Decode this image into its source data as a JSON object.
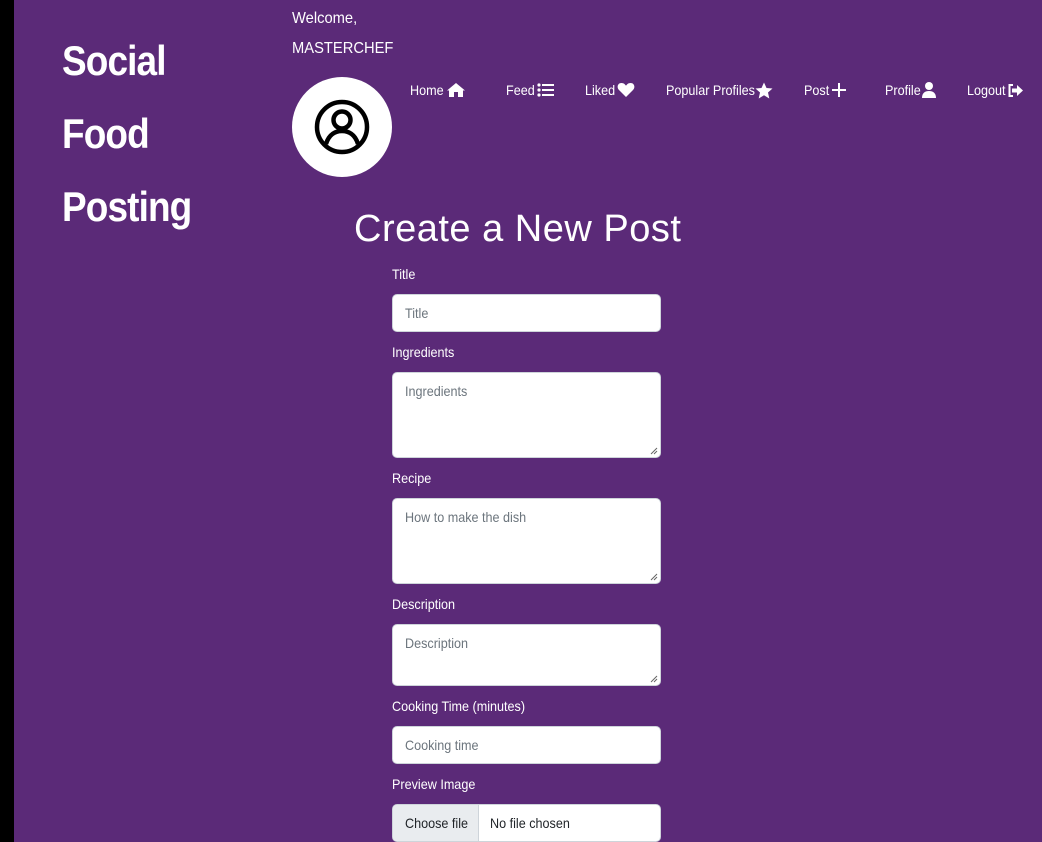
{
  "brand": {
    "line1": "Social Food",
    "line2": "Posting"
  },
  "user": {
    "welcome": "Welcome,",
    "name": "MASTERCHEF"
  },
  "nav": [
    {
      "label": "Home",
      "icon": "home-icon"
    },
    {
      "label": "Feed",
      "icon": "list-icon"
    },
    {
      "label": "Liked",
      "icon": "heart-icon"
    },
    {
      "label": "Popular Profiles",
      "icon": "star-icon"
    },
    {
      "label": "Post",
      "icon": "plus-icon"
    },
    {
      "label": "Profile",
      "icon": "user-icon"
    },
    {
      "label": "Logout",
      "icon": "logout-icon"
    }
  ],
  "page_title": "Create a New Post",
  "form": {
    "title": {
      "label": "Title",
      "placeholder": "Title"
    },
    "ingredients": {
      "label": "Ingredients",
      "placeholder": "Ingredients"
    },
    "recipe": {
      "label": "Recipe",
      "placeholder": "How to make the dish"
    },
    "description": {
      "label": "Description",
      "placeholder": "Description"
    },
    "cooking_time": {
      "label": "Cooking Time (minutes)",
      "placeholder": "Cooking time"
    },
    "preview_image": {
      "label": "Preview Image",
      "button": "Choose file",
      "status": "No file chosen"
    }
  },
  "colors": {
    "background": "#5b2a78",
    "text": "#ffffff",
    "input_bg": "#ffffff"
  }
}
